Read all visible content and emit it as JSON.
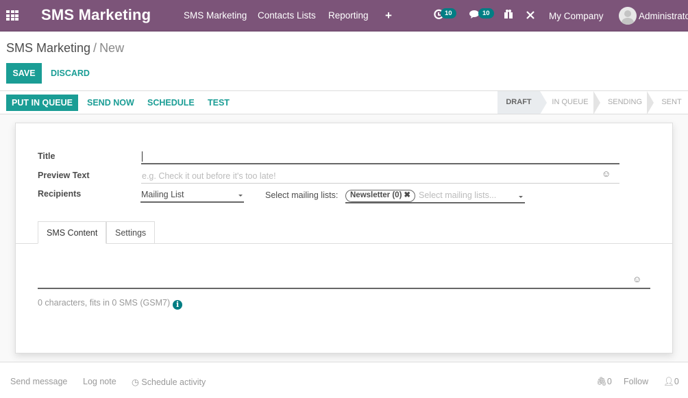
{
  "navbar": {
    "brand": "SMS Marketing",
    "menu": [
      "SMS Marketing",
      "Contacts Lists",
      "Reporting"
    ],
    "activity_count": "10",
    "message_count": "10",
    "company": "My Company",
    "user": "Administrator",
    "colors": {
      "bar": "#7c5479",
      "badge": "#017e84"
    }
  },
  "breadcrumb": {
    "parent": "SMS Marketing",
    "separator": "/",
    "current": "New"
  },
  "actions": {
    "save": "SAVE",
    "discard": "DISCARD"
  },
  "statusbar": {
    "buttons": [
      "PUT IN QUEUE",
      "SEND NOW",
      "SCHEDULE",
      "TEST"
    ],
    "stages": [
      {
        "label": "DRAFT",
        "active": true
      },
      {
        "label": "IN QUEUE",
        "active": false
      },
      {
        "label": "SENDING",
        "active": false
      },
      {
        "label": "SENT",
        "active": false
      }
    ]
  },
  "form": {
    "title_label": "Title",
    "title_value": "",
    "preview_label": "Preview Text",
    "preview_placeholder": "e.g. Check it out before it's too late!",
    "recipients_label": "Recipients",
    "recipients_value": "Mailing List",
    "mailing_lists_label": "Select mailing lists:",
    "mailing_list_tag": "Newsletter (0)",
    "mailing_lists_placeholder": "Select mailing lists..."
  },
  "tabs": [
    "SMS Content",
    "Settings"
  ],
  "sms": {
    "counter": "0 characters, fits in 0 SMS (GSM7)"
  },
  "chatter": {
    "send_message": "Send message",
    "log_note": "Log note",
    "schedule_activity": "Schedule activity",
    "attachments": "0",
    "follow": "Follow",
    "followers": "0"
  },
  "accent_color": "#1a9d95"
}
